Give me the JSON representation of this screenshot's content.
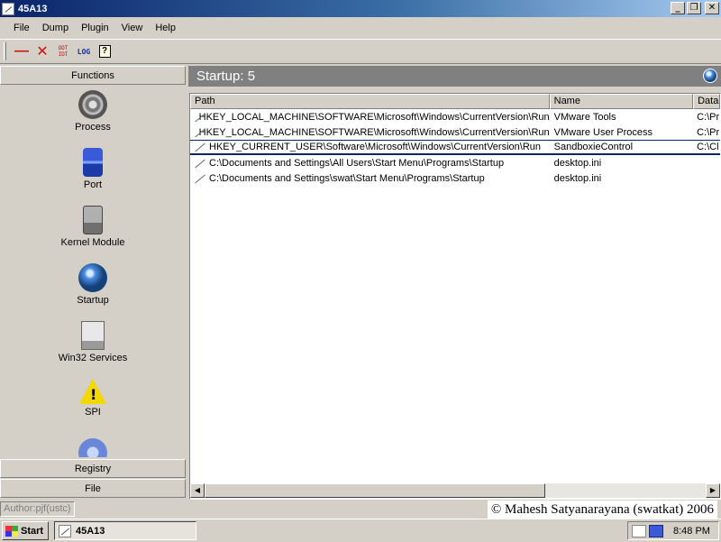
{
  "window": {
    "title": "45A13"
  },
  "title_buttons": {
    "minimize": "_",
    "restore": "❐",
    "close": "✕"
  },
  "menu": [
    "File",
    "Dump",
    "Plugin",
    "View",
    "Help"
  ],
  "toolbar": {
    "icons": [
      "minus-icon",
      "delete-x-icon",
      "odt-icon",
      "log-icon",
      "help-icon"
    ],
    "odt_label_top": "ODT",
    "odt_label_bottom": "IDT",
    "log_label": "LOG",
    "help_label": "?"
  },
  "left_panel": {
    "header": "Functions",
    "functions": [
      {
        "label": "Process",
        "icon": "gear-icon"
      },
      {
        "label": "Port",
        "icon": "port-icon"
      },
      {
        "label": "Kernel Module",
        "icon": "drive-icon"
      },
      {
        "label": "Startup",
        "icon": "globe-icon"
      },
      {
        "label": "Win32 Services",
        "icon": "computer-icon"
      },
      {
        "label": "SPI",
        "icon": "warning-icon"
      }
    ],
    "sections": [
      "Registry",
      "File"
    ]
  },
  "right_panel": {
    "header": "Startup: 5",
    "columns": [
      "Path",
      "Name",
      "Data"
    ],
    "rows": [
      {
        "path": "HKEY_LOCAL_MACHINE\\SOFTWARE\\Microsoft\\Windows\\CurrentVersion\\Run",
        "name": "VMware Tools",
        "data": "C:\\Pr"
      },
      {
        "path": "HKEY_LOCAL_MACHINE\\SOFTWARE\\Microsoft\\Windows\\CurrentVersion\\Run",
        "name": "VMware User Process",
        "data": "C:\\Pr"
      },
      {
        "path": "HKEY_CURRENT_USER\\Software\\Microsoft\\Windows\\CurrentVersion\\Run",
        "name": "SandboxieControl",
        "data": "C:\\Cl"
      },
      {
        "path": "C:\\Documents and Settings\\All Users\\Start Menu\\Programs\\Startup",
        "name": "desktop.ini",
        "data": ""
      },
      {
        "path": "C:\\Documents and Settings\\swat\\Start Menu\\Programs\\Startup",
        "name": "desktop.ini",
        "data": ""
      }
    ],
    "selected_row_index": 2
  },
  "status": {
    "author": "Author:pjf(ustc)",
    "copyright": "© Mahesh Satyanarayana (swatkat) 2006"
  },
  "taskbar": {
    "start_label": "Start",
    "task_label": "45A13",
    "clock": "8:48 PM"
  }
}
